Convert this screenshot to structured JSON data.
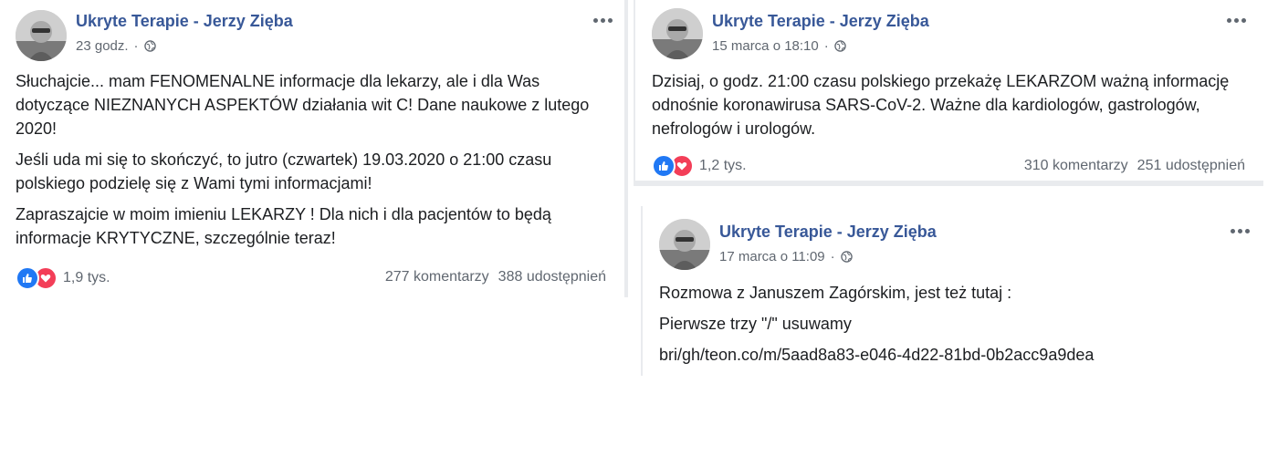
{
  "posts": [
    {
      "author": "Ukryte Terapie - Jerzy Zięba",
      "time": "23 godz.",
      "meta_sep": "·",
      "paragraphs": [
        "Słuchajcie... mam FENOMENALNE informacje dla lekarzy, ale i dla Was dotyczące NIEZNANYCH ASPEKTÓW działania wit C! Dane naukowe z lutego 2020!",
        "Jeśli uda mi się to skończyć, to jutro (czwartek) 19.03.2020 o 21:00 czasu polskiego podzielę się z Wami tymi informacjami!",
        "Zapraszajcie w moim imieniu LEKARZY ! Dla nich i dla pacjentów to będą informacje KRYTYCZNE, szczególnie teraz!"
      ],
      "reactions_count": "1,9 tys.",
      "comments": "277 komentarzy",
      "shares": "388 udostępnień"
    },
    {
      "author": "Ukryte Terapie - Jerzy Zięba",
      "time": "15 marca o 18:10",
      "meta_sep": "·",
      "paragraphs": [
        "Dzisiaj, o godz. 21:00 czasu polskiego przekażę LEKARZOM ważną informację odnośnie koronawirusa SARS-CoV-2. Ważne dla kardiologów, gastrologów, nefrologów i urologów."
      ],
      "reactions_count": "1,2 tys.",
      "comments": "310 komentarzy",
      "shares": "251 udostępnień"
    },
    {
      "author": "Ukryte Terapie - Jerzy Zięba",
      "time": "17 marca o 11:09",
      "meta_sep": "·",
      "paragraphs": [
        "Rozmowa z Januszem Zagórskim, jest też tutaj :",
        "Pierwsze trzy \"/\" usuwamy",
        "bri/gh/teon.co/m/5aad8a83-e046-4d22-81bd-0b2acc9a9dea"
      ]
    }
  ],
  "icons": {
    "avatar": "avatar-photo",
    "privacy": "globe-icon",
    "menu": "more-options-icon",
    "like": "like-reaction-icon",
    "love": "love-reaction-icon"
  },
  "colors": {
    "author_link": "#385898",
    "meta_text": "#606770",
    "like_blue": "#2078f4",
    "love_red": "#f33e58",
    "separator": "#e9ebee"
  }
}
